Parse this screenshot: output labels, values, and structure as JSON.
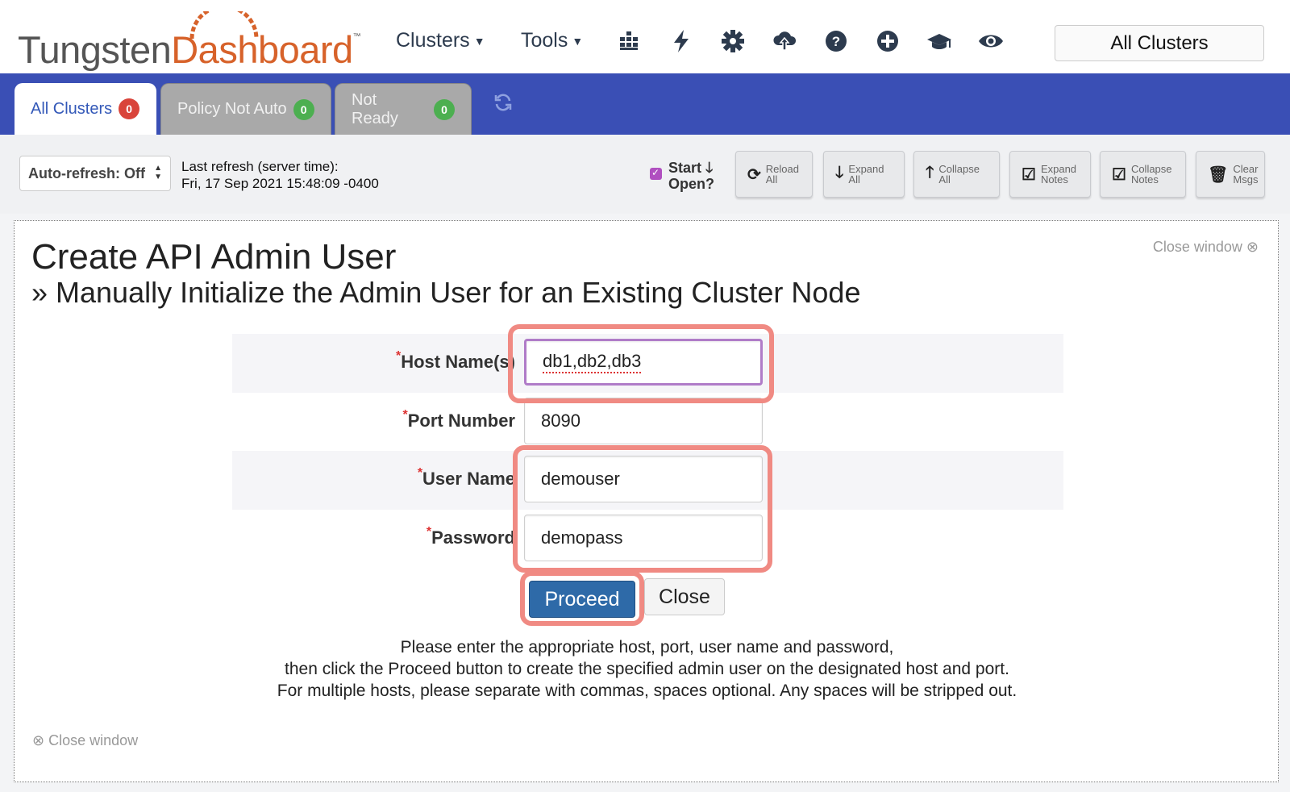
{
  "header": {
    "logo_part1": "Tungsten",
    "logo_part2": "Dashboard",
    "logo_tm": "™",
    "nav_clusters": "Clusters",
    "nav_tools": "Tools",
    "scope_label": "All Clusters",
    "icons": [
      "grid-icon",
      "lightning-icon",
      "gear-icon",
      "cloud-upload-icon",
      "help-icon",
      "plus-circle-icon",
      "graduation-cap-icon",
      "eye-icon"
    ]
  },
  "tabs": [
    {
      "label": "All Clusters",
      "count": "0",
      "badge_color": "#d9443a"
    },
    {
      "label": "Policy Not Auto",
      "count": "0",
      "badge_color": "#4caf50"
    },
    {
      "label": "Not Ready",
      "count": "0",
      "badge_color": "#4caf50"
    }
  ],
  "toolbar": {
    "autorefresh": "Auto-refresh: Off",
    "last_refresh_label": "Last refresh (server time):",
    "last_refresh_value": "Fri, 17 Sep 2021 15:48:09 -0400",
    "start_open_line1": "Start",
    "start_open_line2": "Open?",
    "buttons": [
      {
        "line1": "Reload",
        "line2": "All"
      },
      {
        "line1": "Expand",
        "line2": "All"
      },
      {
        "line1": "Collapse",
        "line2": "All"
      },
      {
        "line1": "Expand",
        "line2": "Notes"
      },
      {
        "line1": "Collapse",
        "line2": "Notes"
      },
      {
        "line1": "Clear",
        "line2": "Msgs"
      }
    ]
  },
  "panel": {
    "close_window": "Close window",
    "title": "Create API Admin User",
    "subtitle": "» Manually Initialize the Admin User for an Existing Cluster Node",
    "fields": {
      "host_label": "Host Name(s)",
      "host_value": "db1,db2,db3",
      "port_label": "Port Number",
      "port_value": "8090",
      "user_label": "User Name",
      "user_value": "demouser",
      "pass_label": "Password",
      "pass_value": "demopass"
    },
    "required_mark": "*",
    "proceed": "Proceed",
    "close": "Close",
    "help_line1": "Please enter the appropriate host, port, user name and password,",
    "help_line2": "then click the Proceed button to create the specified admin user on the designated host and port.",
    "help_line3": "For multiple hosts, please separate with commas, spaces optional. Any spaces will be stripped out.",
    "close_window_bottom": "Close window"
  },
  "colors": {
    "accent_blue": "#3a4fb5",
    "brand_orange": "#d7622a",
    "highlight": "#f08a83",
    "proceed_blue": "#2e6aa8"
  }
}
